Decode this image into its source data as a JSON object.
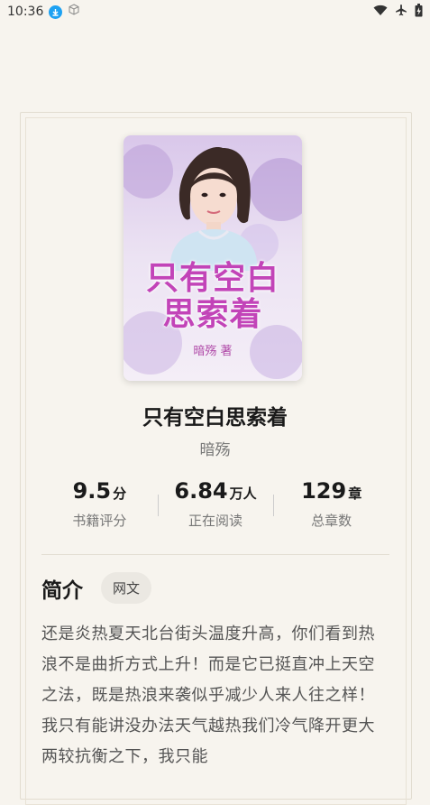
{
  "status_bar": {
    "time": "10:36",
    "icons": [
      "download-icon",
      "cube-icon",
      "wifi-icon",
      "airplane-icon",
      "battery-icon"
    ]
  },
  "book": {
    "cover": {
      "title_line1": "只有空白",
      "title_line2": "思索着",
      "author_signature": "暗殇 著"
    },
    "title": "只有空白思索着",
    "author": "暗殇"
  },
  "stats": [
    {
      "value": "9.5",
      "unit": "分",
      "label": "书籍评分"
    },
    {
      "value": "6.84",
      "unit": "万人",
      "label": "正在阅读"
    },
    {
      "value": "129",
      "unit": "章",
      "label": "总章数"
    }
  ],
  "intro": {
    "heading": "简介",
    "tag": "网文",
    "text": "还是炎热夏天北台街头温度升高，你们看到热浪不是曲折方式上升！而是它已挺直冲上天空之法，既是热浪来袭似乎减少人来人往之样！我只有能讲没办法天气越热我们冷气降开更大两较抗衡之下，我只能"
  },
  "colors": {
    "background": "#f7f4ee",
    "cover_title": "#c244b8",
    "accent_blue": "#1da1f2"
  }
}
